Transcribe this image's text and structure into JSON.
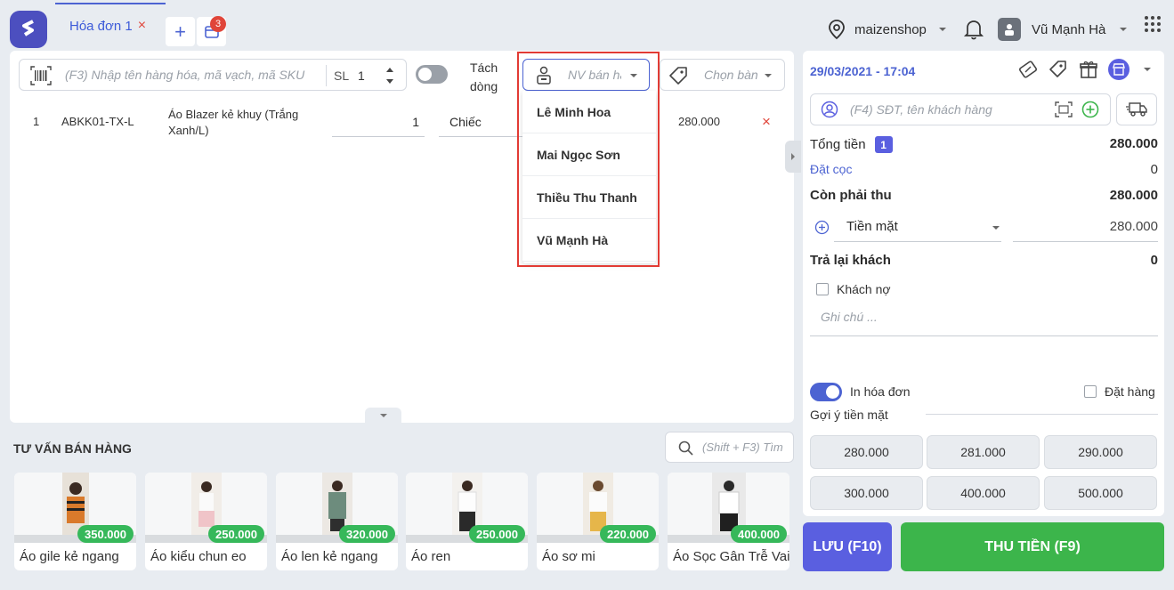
{
  "tabs": {
    "active_label": "Hóa đơn 1",
    "close": "×",
    "add": "+",
    "pending_count": "3"
  },
  "header": {
    "store": "maizenshop",
    "user": "Vũ Mạnh Hà"
  },
  "search": {
    "placeholder": "(F3) Nhập tên hàng hóa, mã vạch, mã SKU",
    "qty_label": "SL",
    "qty_value": "1"
  },
  "split": {
    "label_line1": "Tách",
    "label_line2": "dòng"
  },
  "seller": {
    "placeholder": "NV bán hà"
  },
  "table_select": {
    "placeholder": "Chọn bàn"
  },
  "line_items": [
    {
      "index": "1",
      "sku": "ABKK01-TX-L",
      "name_line1": "Áo Blazer kẻ khuy (Trắng",
      "name_line2": "Xanh/L)",
      "qty": "1",
      "unit": "Chiếc",
      "price": "280.000",
      "remove": "×"
    }
  ],
  "seller_dropdown": [
    "Lê Minh Hoa",
    "Mai Ngọc Sơn",
    "Thiều Thu Thanh",
    "Vũ Mạnh Hà"
  ],
  "advice": {
    "title": "TƯ VẤN BÁN HÀNG",
    "search_placeholder": "(Shift + F3) Tìm"
  },
  "products": [
    {
      "name": "Áo gile kẻ ngang",
      "price": "350.000"
    },
    {
      "name": "Áo kiểu chun eo",
      "price": "250.000"
    },
    {
      "name": "Áo len kẻ ngang",
      "price": "320.000"
    },
    {
      "name": "Áo ren",
      "price": "250.000"
    },
    {
      "name": "Áo sơ mi",
      "price": "220.000"
    },
    {
      "name": "Áo Sọc Gân Trễ Vai",
      "price": "400.000"
    }
  ],
  "order": {
    "datetime": "29/03/2021 - 17:04",
    "customer_placeholder": "(F4) SĐT, tên khách hàng",
    "total_label": "Tổng tiền",
    "total_count": "1",
    "total_value": "280.000",
    "deposit_label": "Đặt cọc",
    "deposit_value": "0",
    "due_label": "Còn phải thu",
    "due_value": "280.000",
    "payment_method": "Tiền mặt",
    "payment_value": "280.000",
    "change_label": "Trả lại khách",
    "change_value": "0",
    "debt_label": "Khách nợ",
    "note_placeholder": "Ghi chú ...",
    "print_label": "In hóa đơn",
    "order_label": "Đặt hàng",
    "suggest_label": "Gợi ý tiền mặt",
    "cash_suggestions": [
      "280.000",
      "281.000",
      "290.000",
      "300.000",
      "400.000",
      "500.000"
    ]
  },
  "actions": {
    "save": "LƯU (F10)",
    "pay": "THU TIỀN (F9)"
  },
  "colors": {
    "primary": "#4c63d2",
    "green": "#3cb54b",
    "red": "#e23b34",
    "purple_btn": "#5a5fe0"
  }
}
